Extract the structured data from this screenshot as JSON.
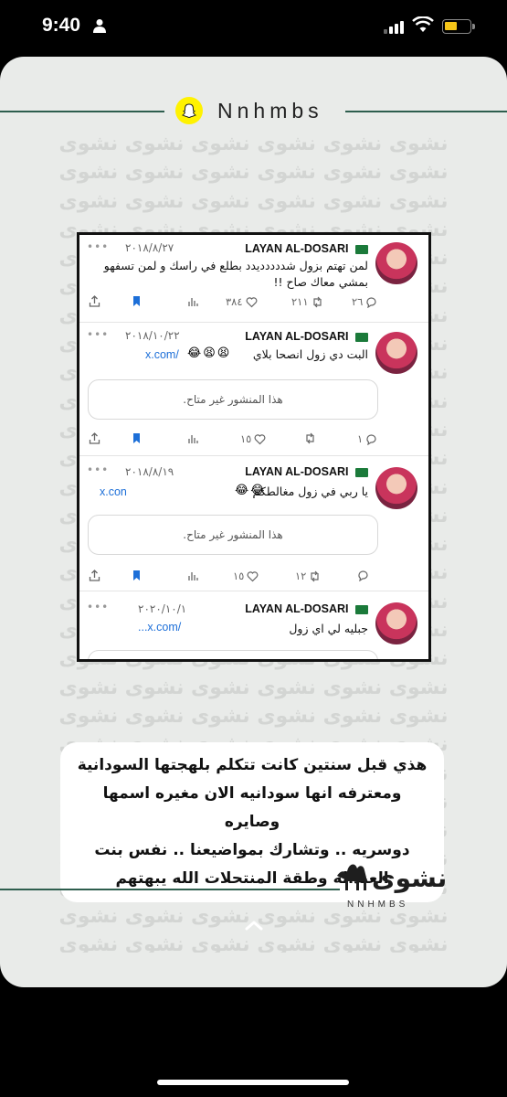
{
  "status_bar": {
    "time": "9:40"
  },
  "header": {
    "brand": "Nnhmbs"
  },
  "watermark": {
    "text": "نشوى نشوى نشوى نشوى نشوى نشوى"
  },
  "tweets": [
    {
      "name": "LAYAN AL-DOSARI",
      "date": "٢٠١٨/٨/٢٧",
      "text": "لمن تهتم بزول شددددديدد بطلع في راسك و لمن تسفهو بمشي معاك صاح !!",
      "replies": "٢٦",
      "retweets": "٢١١",
      "likes": "٣٨٤"
    },
    {
      "name": "LAYAN AL-DOSARI",
      "date": "٢٠١٨/١٠/٢٢",
      "text": "البت دي زول انصحا بلاي",
      "emoji": "😂😫😫",
      "link": "x.com/",
      "unavailable": "هذا المنشور غير متاح.",
      "replies": "١",
      "likes": "١٥"
    },
    {
      "name": "LAYAN AL-DOSARI",
      "date": "٢٠١٨/٨/١٩",
      "text": "يا ربي في زول مغالطكم",
      "emoji": "😂😂",
      "link": "x.con",
      "unavailable": "هذا المنشور غير متاح.",
      "retweets": "١٢",
      "likes": "١٥"
    },
    {
      "name": "LAYAN AL-DOSARI",
      "date": "٢٠٢٠/١٠/١",
      "text": "جبليه لي اي زول",
      "link": "...x.com/"
    }
  ],
  "caption": {
    "lines": [
      "هذي قبل سنتين كانت تتكلم بلهجتها السودانية",
      "ومعترفه انها سودانيه الان مغيره اسمها وصايره",
      "دوسريه .. وتشارك بمواضيعنا .. نفس بنت",
      "العبداله وطقة المنتحلات الله يبهتهم"
    ]
  },
  "footer": {
    "logo_text": "نشوى",
    "brand": "NNHMBS"
  },
  "colors": {
    "accent_line": "#2e5e4e",
    "card_bg": "#e9ebe9",
    "link": "#1d6fd8",
    "bookmark": "#1d6fd8"
  }
}
